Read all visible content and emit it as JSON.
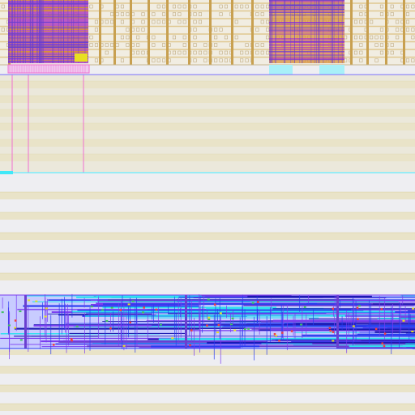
{
  "view": {
    "kind": "ic-layout-view",
    "background": "#eeeef2"
  },
  "palette": {
    "power_rail": "#e9e3c8",
    "power_rail_edge": "#d9cf9c",
    "cell_tan": "#c8a050",
    "cell_tan_light": "#e0c890",
    "macro_magenta": "#b040c0",
    "macro_purple": "#6a3fd0",
    "macro_orange": "#d8903a",
    "metal_blue": "#2a3cf0",
    "metal_blue_dark": "#1a1ab0",
    "metal_violet": "#7a3cf0",
    "metal_cyan": "#30e0f0",
    "outline_pink": "#f070d0",
    "outline_cyan": "#40e8f8",
    "accent_yellow": "#e8e020",
    "accent_green": "#40c060"
  },
  "layers": [
    {
      "name": "standard-cell-rows",
      "color": "#c8a050"
    },
    {
      "name": "power-rails",
      "color": "#e9e3c8"
    },
    {
      "name": "macro-block-left",
      "color": "#b040c0"
    },
    {
      "name": "macro-block-right",
      "color": "#d8903a"
    },
    {
      "name": "routing-metal-band",
      "color": "#2a3cf0"
    },
    {
      "name": "cell-outlines",
      "color": "#f070d0"
    },
    {
      "name": "boundary-lines",
      "color": "#40e8f8"
    }
  ]
}
